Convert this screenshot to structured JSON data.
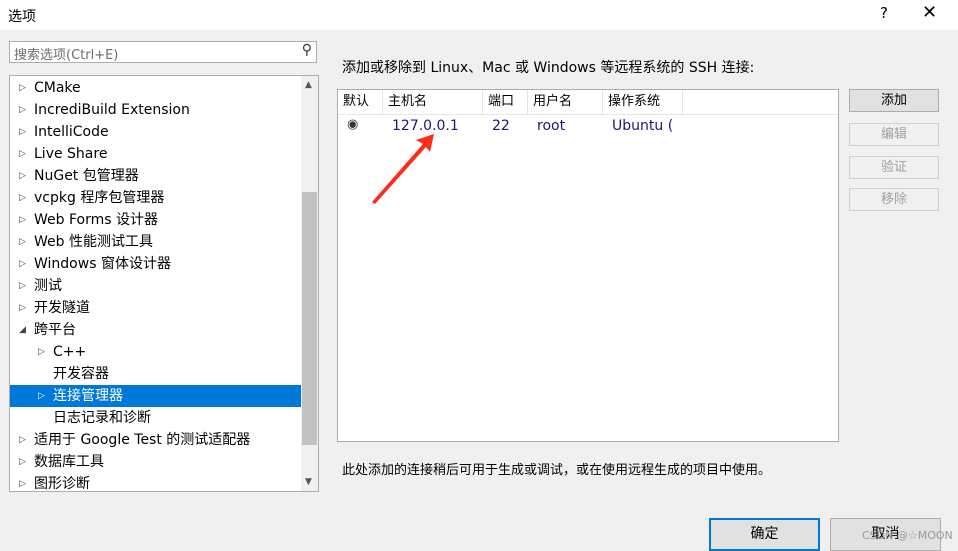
{
  "window": {
    "title": "选项",
    "help": "?",
    "close": "✕"
  },
  "search": {
    "placeholder": "搜索选项(Ctrl+E)",
    "icon": "search-icon"
  },
  "tree": [
    {
      "label": "CMake",
      "level": 0,
      "expander": "collapsed"
    },
    {
      "label": "IncrediBuild Extension",
      "level": 0,
      "expander": "collapsed"
    },
    {
      "label": "IntelliCode",
      "level": 0,
      "expander": "collapsed"
    },
    {
      "label": "Live Share",
      "level": 0,
      "expander": "collapsed"
    },
    {
      "label": "NuGet 包管理器",
      "level": 0,
      "expander": "collapsed"
    },
    {
      "label": "vcpkg 程序包管理器",
      "level": 0,
      "expander": "collapsed"
    },
    {
      "label": "Web Forms 设计器",
      "level": 0,
      "expander": "collapsed"
    },
    {
      "label": "Web 性能测试工具",
      "level": 0,
      "expander": "collapsed"
    },
    {
      "label": "Windows 窗体设计器",
      "level": 0,
      "expander": "collapsed"
    },
    {
      "label": "测试",
      "level": 0,
      "expander": "collapsed"
    },
    {
      "label": "开发隧道",
      "level": 0,
      "expander": "collapsed"
    },
    {
      "label": "跨平台",
      "level": 0,
      "expander": "expanded"
    },
    {
      "label": "C++",
      "level": 1,
      "expander": "collapsed"
    },
    {
      "label": "开发容器",
      "level": 1,
      "expander": "none"
    },
    {
      "label": "连接管理器",
      "level": 1,
      "expander": "collapsed",
      "selected": true
    },
    {
      "label": "日志记录和诊断",
      "level": 1,
      "expander": "none"
    },
    {
      "label": "适用于 Google Test 的测试适配器",
      "level": 0,
      "expander": "collapsed"
    },
    {
      "label": "数据库工具",
      "level": 0,
      "expander": "collapsed"
    },
    {
      "label": "图形诊断",
      "level": 0,
      "expander": "collapsed"
    }
  ],
  "main": {
    "description": "添加或移除到 Linux、Mac 或 Windows 等远程系统的 SSH 连接:",
    "columns": [
      "默认",
      "主机名",
      "端口",
      "用户名",
      "操作系统"
    ],
    "rows": [
      {
        "default": true,
        "host": "127.0.0.1",
        "port": "22",
        "user": "root",
        "os": "Ubuntu ("
      }
    ],
    "buttons": {
      "add": "添加",
      "edit": "编辑",
      "verify": "验证",
      "remove": "移除"
    },
    "note": "此处添加的连接稍后可用于生成或调试，或在使用远程生成的项目中使用。"
  },
  "footer": {
    "ok": "确定",
    "cancel": "取消"
  },
  "watermark": "CSDN @☆MOON",
  "colors": {
    "selection": "#0078d7",
    "annotation_arrow": "#ff2a1a"
  }
}
